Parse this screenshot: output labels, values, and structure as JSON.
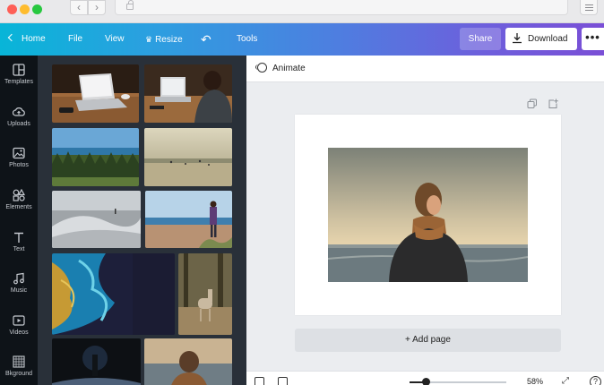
{
  "toolbar": {
    "home_label": "Home",
    "file_label": "File",
    "view_label": "View",
    "resize_label": "Resize",
    "tools_label": "Tools",
    "share_label": "Share",
    "download_label": "Download",
    "more_label": "•••"
  },
  "sidebar": {
    "items": [
      {
        "label": "Templates",
        "icon": "templates-icon"
      },
      {
        "label": "Uploads",
        "icon": "cloud-upload-icon"
      },
      {
        "label": "Photos",
        "icon": "photo-icon"
      },
      {
        "label": "Elements",
        "icon": "shapes-icon"
      },
      {
        "label": "Text",
        "icon": "text-icon"
      },
      {
        "label": "Music",
        "icon": "music-note-icon"
      },
      {
        "label": "Videos",
        "icon": "video-icon"
      },
      {
        "label": "Bkground",
        "icon": "background-pattern-icon"
      }
    ]
  },
  "editor": {
    "animate_label": "Animate",
    "add_page_label": "+ Add page",
    "zoom_percent": 58,
    "zoom_label": "58%",
    "help_label": "?"
  },
  "colors": {
    "toolbar_gradient_start": "#08b5d8",
    "toolbar_gradient_end": "#7a4fd6",
    "rail_bg": "#0e1318",
    "panel_bg": "#293039",
    "canvas_bg": "#ebedf0"
  }
}
